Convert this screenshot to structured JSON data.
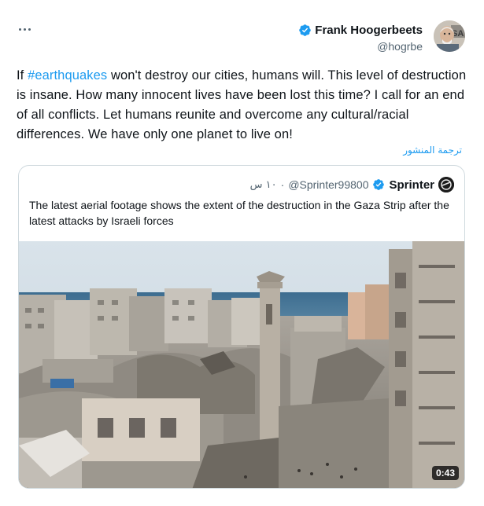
{
  "author": {
    "display_name": "Frank Hoogerbeets",
    "handle": "@hogrbe",
    "avatar": "profile-photo"
  },
  "tweet": {
    "text_before_hashtag": "If ",
    "hashtag": "#earthquakes",
    "text_after_hashtag": " won't destroy our cities, humans will. This level of destruction is insane. How many innocent lives have been lost this time? I call for an end of all conflicts. Let humans reunite and overcome any cultural/racial differences. We have only one planet to live on!",
    "translate_label": "ترجمة المنشور"
  },
  "quoted": {
    "display_name": "Sprinter",
    "handle": "@Sprinter99800",
    "separator": "·",
    "time": "١٠ س",
    "text": "The latest aerial footage shows the extent of the destruction in the Gaza Strip after the latest attacks by Israeli forces",
    "video_duration": "0:43"
  },
  "colors": {
    "accent": "#1d9bf0",
    "text": "#0f1419",
    "secondary": "#536471",
    "border": "#cfd9de"
  },
  "icons": {
    "more": "more-horizontal-icon",
    "verified": "verified-badge-icon"
  }
}
